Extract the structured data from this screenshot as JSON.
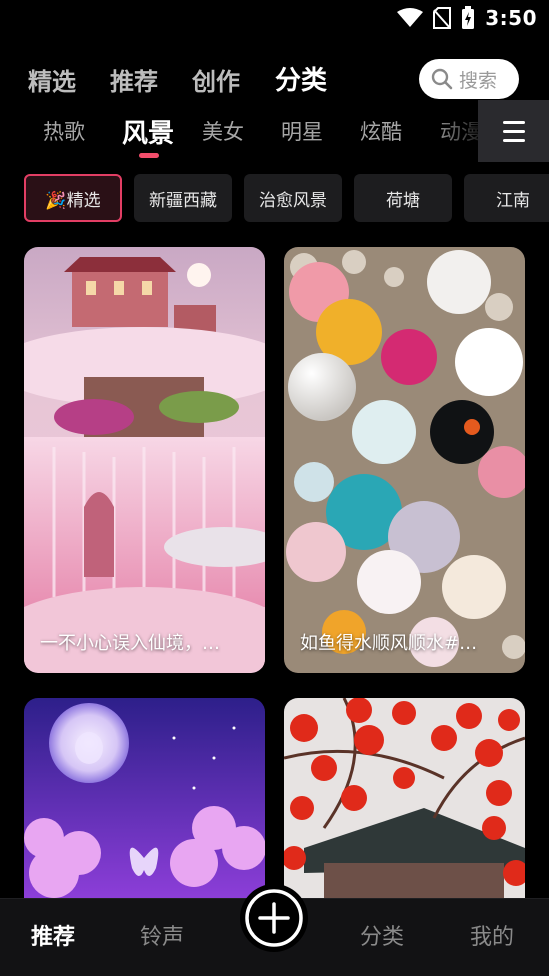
{
  "status_bar": {
    "time": "3:50",
    "icons": [
      "wifi-icon",
      "no-sim-icon",
      "battery-charging-icon"
    ]
  },
  "top_nav": {
    "tabs": [
      {
        "label": "精选",
        "active": false
      },
      {
        "label": "推荐",
        "active": false
      },
      {
        "label": "创作",
        "active": false
      },
      {
        "label": "分类",
        "active": true
      }
    ],
    "search_placeholder": "搜索"
  },
  "category_tabs": [
    {
      "label": "热歌",
      "active": false
    },
    {
      "label": "风景",
      "active": true
    },
    {
      "label": "美女",
      "active": false
    },
    {
      "label": "明星",
      "active": false
    },
    {
      "label": "炫酷",
      "active": false
    },
    {
      "label": "动漫",
      "active": false
    }
  ],
  "chips": [
    {
      "label": "🎉精选",
      "active": true
    },
    {
      "label": "新疆西藏",
      "active": false
    },
    {
      "label": "治愈风景",
      "active": false
    },
    {
      "label": "荷塘",
      "active": false
    },
    {
      "label": "江南",
      "active": false
    }
  ],
  "cards": [
    {
      "caption": "一不小心误入仙境，…",
      "scene": "pink-waterfall-palace"
    },
    {
      "caption": "如鱼得水顺风顺水#…",
      "scene": "colorful-gem-orbs"
    },
    {
      "caption": "",
      "scene": "purple-moon-rabbit-butterfly"
    },
    {
      "caption": "",
      "scene": "red-persimmons-snow"
    }
  ],
  "bottom_nav": {
    "items": [
      {
        "label": "推荐",
        "active": true
      },
      {
        "label": "铃声",
        "active": false
      },
      {
        "label": "分类",
        "active": false
      },
      {
        "label": "我的",
        "active": false
      }
    ],
    "center_button_icon": "plus-circle-icon"
  },
  "colors": {
    "accent": "#f24d6b",
    "background": "#000000",
    "chip_bg": "#1d1d1f"
  }
}
